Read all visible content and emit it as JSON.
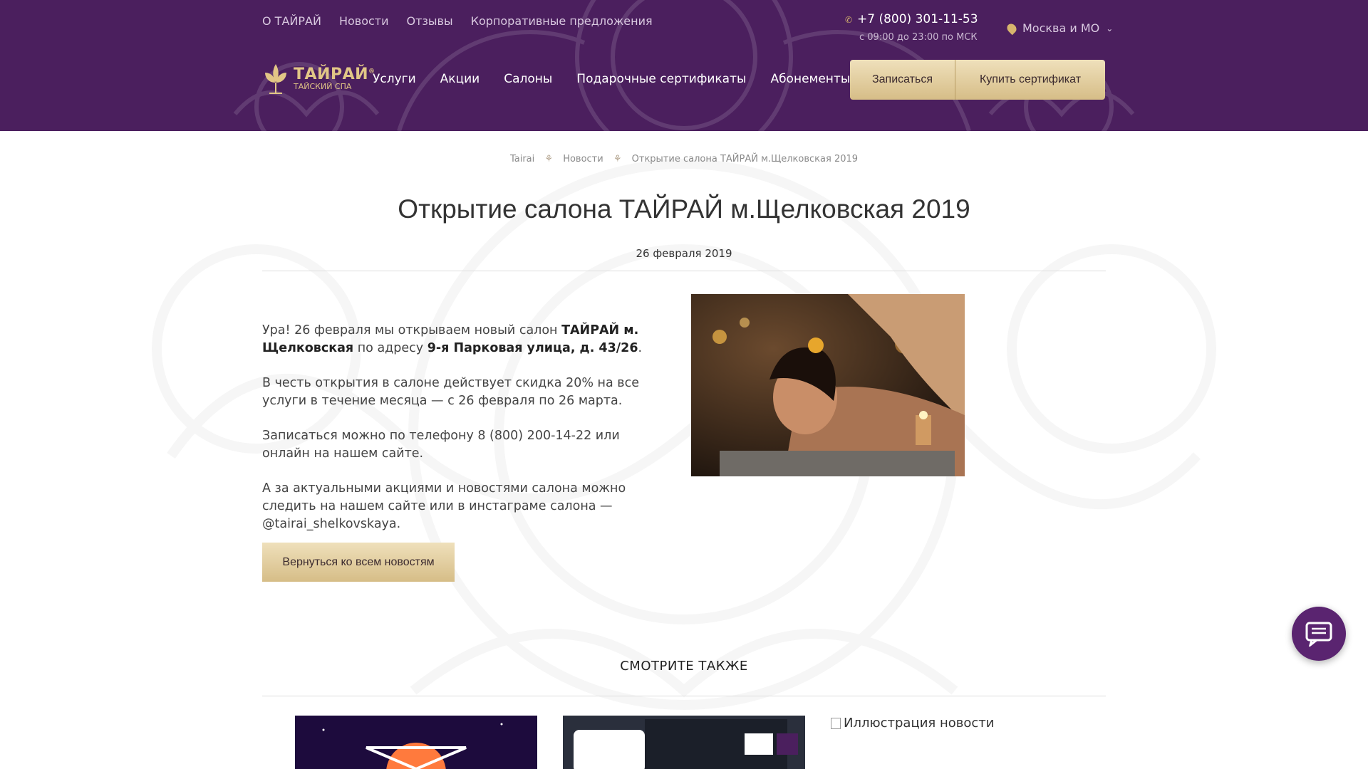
{
  "topnav": [
    "О ТАЙРАЙ",
    "Новости",
    "Отзывы",
    "Корпоративные предложения"
  ],
  "contact": {
    "phone": "+7 (800) 301-11-53",
    "hours": "с 09:00 до 23:00 по МСК",
    "city": "Москва и МО"
  },
  "logo": {
    "title": "ТАЙРАЙ",
    "subtitle": "ТАЙСКИЙ СПА",
    "reg": "®"
  },
  "mainnav": [
    "Услуги",
    "Акции",
    "Салоны",
    "Подарочные сертификаты",
    "Абонементы"
  ],
  "buttons": {
    "signup": "Записаться",
    "certificate": "Купить сертификат"
  },
  "breadcrumb": [
    "Tairai",
    "Новости",
    "Открытие салона ТАЙРАЙ м.Щелковская 2019"
  ],
  "article": {
    "title": "Открытие салона ТАЙРАЙ м.Щелковская 2019",
    "date": "26 февраля 2019",
    "p1_a": "Ура! 26 февраля мы открываем новый салон ",
    "p1_b": "ТАЙРАЙ м. Щелковская",
    "p1_c": " по адресу ",
    "p1_d": "9-я Парковая улица, д. 43/26",
    "p1_e": ".",
    "p2": "В честь открытия в салоне действует скидка 20% на все услуги в течение месяца — с 26 февраля по 26 марта.",
    "p3": "Записаться можно по телефону 8 (800) 200-14-22 или онлайн на нашем сайте.",
    "p4": "А за актуальными акциями и новостями салона можно следить на нашем сайте или в инстаграме салона — @tairai_shelkovskaya.",
    "back_button": "Вернуться ко всем новостям"
  },
  "see_also": {
    "heading": "СМОТРИТЕ ТАКЖЕ",
    "broken_alt": "Иллюстрация новости"
  },
  "colors": {
    "header_bg": "#4b1f5e",
    "gold": "#d6bd87",
    "chat": "#5a2470"
  }
}
